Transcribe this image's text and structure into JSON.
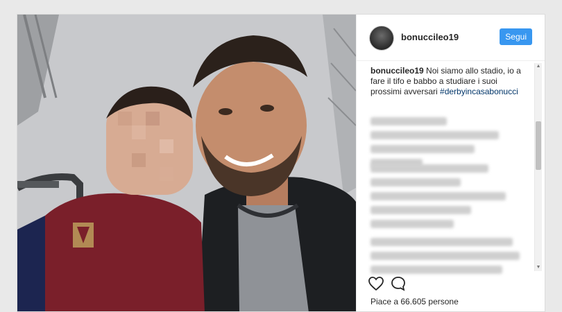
{
  "post": {
    "username": "bonuccileo19",
    "follow_label": "Segui",
    "caption_user": "bonuccileo19",
    "caption_text": " Noi siamo allo stadio, io a fare il tifo e babbo a studiare i suoi prossimi avversari ",
    "caption_hashtag": "#derbyincasabonucci",
    "likes_text": "Piace a 66.605 persone"
  },
  "colors": {
    "follow_blue": "#3897f0",
    "hashtag": "#003569"
  },
  "icons": {
    "like": "heart-outline",
    "comment": "speech-bubble-outline"
  }
}
